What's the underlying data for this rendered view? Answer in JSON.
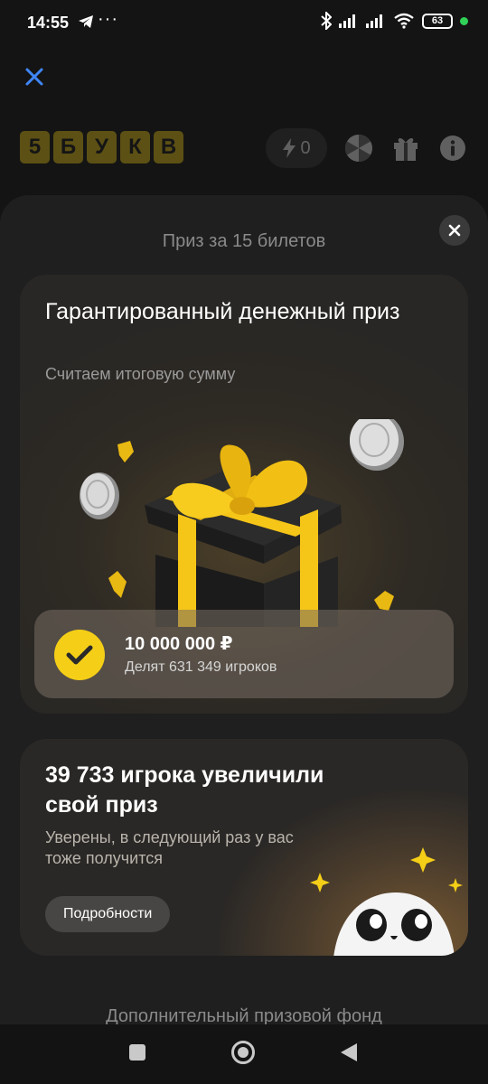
{
  "status_bar": {
    "time": "14:55",
    "more_glyph": "···",
    "battery": "63",
    "icons": [
      "telegram-icon",
      "bluetooth-icon",
      "signal-icon",
      "signal-icon",
      "wifi-icon",
      "battery-icon",
      "green-dot-icon"
    ]
  },
  "app_bar": {
    "logo_letters": [
      "5",
      "Б",
      "У",
      "К",
      "В"
    ],
    "energy_count": "0",
    "icons": [
      "close-icon",
      "bolt-icon",
      "wheel-icon",
      "gift-icon",
      "info-icon"
    ]
  },
  "sheet": {
    "title": "Приз за 15 билетов",
    "guaranteed_card": {
      "title": "Гарантированный денежный приз",
      "subtitle": "Считаем итоговую сумму",
      "prize_amount": "10 000 000 ₽",
      "prize_shared": "Делят 631 349 игроков"
    },
    "increase_card": {
      "title": "39 733 игрока увеличили свой приз",
      "subtitle": "Уверены, в следующий раз у вас тоже получится",
      "button_label": "Подробности"
    },
    "fund_title": "Дополнительный призовой фонд"
  },
  "colors": {
    "accent_yellow": "#f5cf17",
    "background": "#141414",
    "sheet": "#1f1f1f"
  }
}
